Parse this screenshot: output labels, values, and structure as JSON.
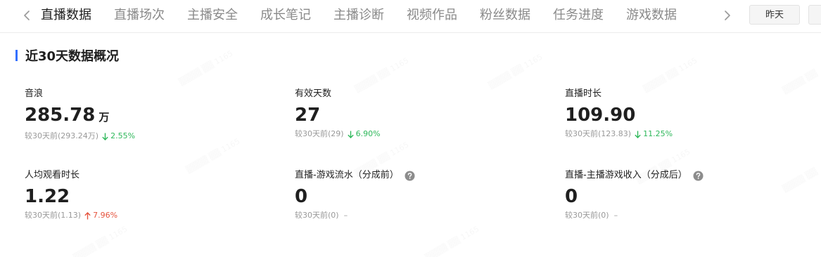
{
  "tabs": [
    {
      "label": "直播数据",
      "active": true
    },
    {
      "label": "直播场次",
      "active": false
    },
    {
      "label": "主播安全",
      "active": false
    },
    {
      "label": "成长笔记",
      "active": false
    },
    {
      "label": "主播诊断",
      "active": false
    },
    {
      "label": "视频作品",
      "active": false
    },
    {
      "label": "粉丝数据",
      "active": false
    },
    {
      "label": "任务进度",
      "active": false
    },
    {
      "label": "游戏数据",
      "active": false
    }
  ],
  "date_filter": {
    "yesterday_label": "昨天"
  },
  "section": {
    "title": "近30天数据概况"
  },
  "metrics": [
    {
      "label": "音浪",
      "value": "285.78",
      "unit": "万",
      "compare": "较30天前(293.24万)",
      "change": "2.55%",
      "direction": "down"
    },
    {
      "label": "有效天数",
      "value": "27",
      "unit": "",
      "compare": "较30天前(29)",
      "change": "6.90%",
      "direction": "down"
    },
    {
      "label": "直播时长",
      "value": "109.90",
      "unit": "",
      "compare": "较30天前(123.83)",
      "change": "11.25%",
      "direction": "down"
    },
    {
      "label": "人均观看时长",
      "value": "1.22",
      "unit": "",
      "compare": "较30天前(1.13)",
      "change": "7.96%",
      "direction": "up"
    },
    {
      "label": "直播-游戏流水（分成前）",
      "value": "0",
      "unit": "",
      "compare": "较30天前(0)",
      "change": "–",
      "direction": "flat"
    },
    {
      "label": "直播-主播游戏收入（分成后）",
      "value": "0",
      "unit": "",
      "compare": "较30天前(0)",
      "change": "–",
      "direction": "flat"
    }
  ],
  "colors": {
    "accent": "#3370ff",
    "down": "#2fb85b",
    "up": "#e5533d"
  },
  "icons": {
    "tabs_left": "chevron-left-icon",
    "tabs_right": "chevron-right-icon",
    "help": "question-circle-icon",
    "down": "arrow-down-icon",
    "up": "arrow-up-icon"
  }
}
